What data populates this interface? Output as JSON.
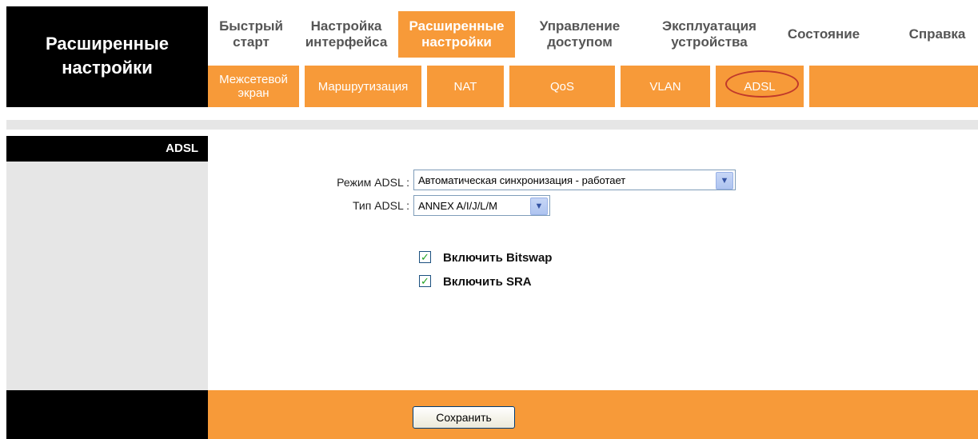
{
  "brand": {
    "title": "Расширенные настройки"
  },
  "top_menu": [
    {
      "label": "Быстрый старт",
      "active": false
    },
    {
      "label": "Настройка интерфейса",
      "active": false
    },
    {
      "label": "Расширенные настройки",
      "active": true
    },
    {
      "label": "Управление доступом",
      "active": false
    },
    {
      "label": "Эксплуатация устройства",
      "active": false
    },
    {
      "label": "Состояние",
      "active": false
    },
    {
      "label": "Справка",
      "active": false
    }
  ],
  "sub_menu": [
    {
      "label": "Межсетевой экран"
    },
    {
      "label": "Маршрутизация"
    },
    {
      "label": "NAT"
    },
    {
      "label": "QoS"
    },
    {
      "label": "VLAN"
    },
    {
      "label": "ADSL",
      "selected": true
    }
  ],
  "sidebar": {
    "section": "ADSL"
  },
  "form": {
    "mode_label": "Режим ADSL :",
    "mode_value": "Автоматическая синхронизация - работает",
    "type_label": "Тип ADSL :",
    "type_value": "ANNEX A/I/J/L/M",
    "bitswap_label": "Включить Bitswap",
    "bitswap_checked": true,
    "sra_label": "Включить SRA",
    "sra_checked": true
  },
  "footer": {
    "save_label": "Сохранить"
  },
  "colors": {
    "accent": "#f79a39",
    "dark": "#000000",
    "panel": "#e6e6e6"
  },
  "icons": {
    "dropdown": "chevron-down-icon",
    "checkbox": "checkmark-icon"
  }
}
